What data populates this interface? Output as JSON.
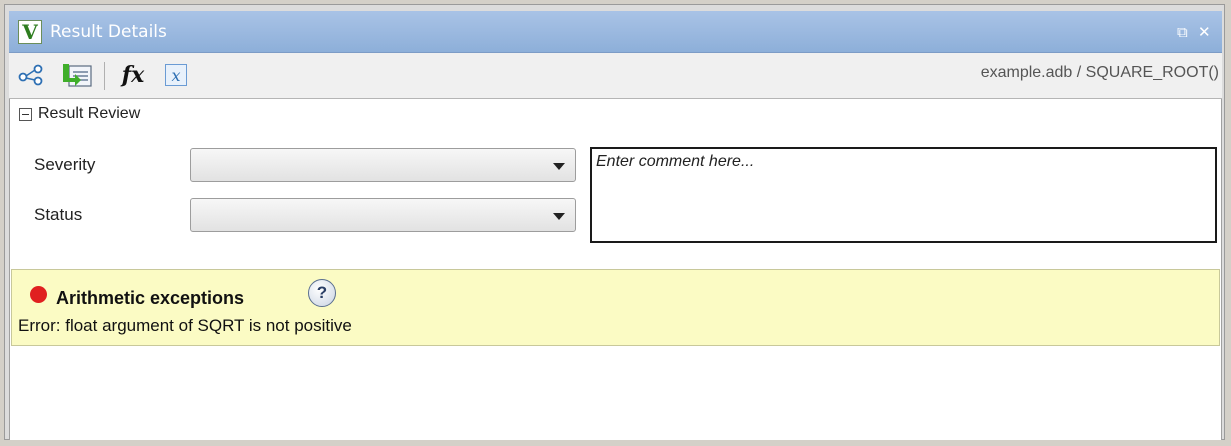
{
  "window": {
    "title": "Result Details",
    "app_icon_letter": "V",
    "restore_glyph": "⧉",
    "close_glyph": "✕"
  },
  "toolbar": {
    "icons": [
      "call-graph-icon",
      "export-icon",
      "function-fx-icon",
      "variable-x-icon"
    ],
    "fx_label": "fx",
    "x_label": "x",
    "location": "example.adb / SQUARE_ROOT()"
  },
  "review": {
    "section_title": "Result Review",
    "severity_label": "Severity",
    "severity_value": "",
    "status_label": "Status",
    "status_value": "",
    "comment_placeholder": "Enter comment here..."
  },
  "result": {
    "status_color": "#e02020",
    "check_name": "Arithmetic exceptions",
    "help_glyph": "?",
    "message": "Error: float argument of SQRT is not positive"
  }
}
